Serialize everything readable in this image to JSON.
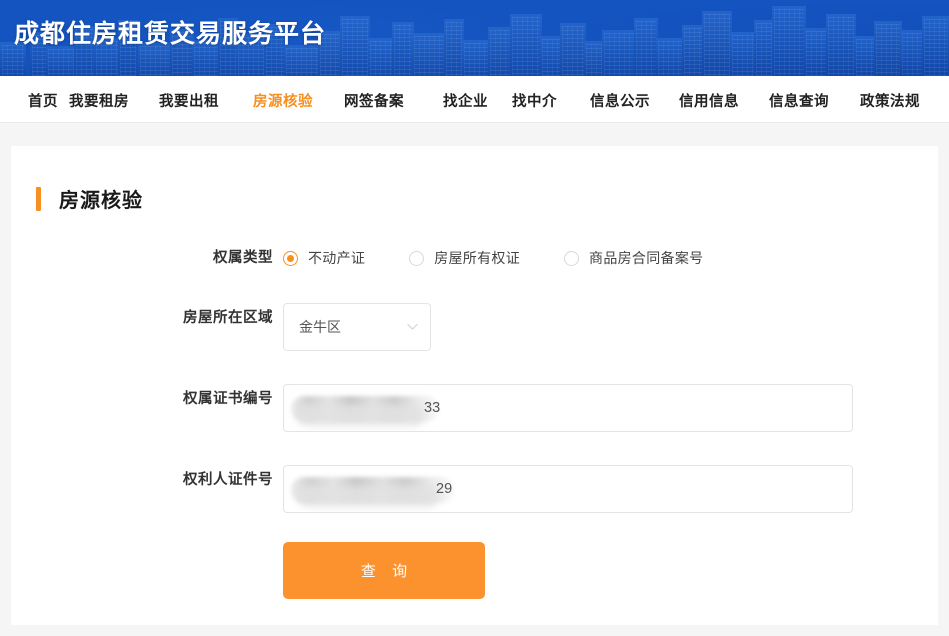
{
  "site": {
    "title": "成都住房租赁交易服务平台"
  },
  "nav": {
    "items": [
      {
        "label": "首页",
        "active": false
      },
      {
        "label": "我要租房",
        "active": false
      },
      {
        "label": "我要出租",
        "active": false
      },
      {
        "label": "房源核验",
        "active": true
      },
      {
        "label": "网签备案",
        "active": false
      },
      {
        "label": "找企业",
        "active": false
      },
      {
        "label": "找中介",
        "active": false
      },
      {
        "label": "信息公示",
        "active": false
      },
      {
        "label": "信用信息",
        "active": false
      },
      {
        "label": "信息查询",
        "active": false
      },
      {
        "label": "政策法规",
        "active": false
      }
    ]
  },
  "panel": {
    "title": "房源核验"
  },
  "form": {
    "ownership_type": {
      "label": "权属类型",
      "options": [
        {
          "label": "不动产证",
          "checked": true
        },
        {
          "label": "房屋所有权证",
          "checked": false
        },
        {
          "label": "商品房合同备案号",
          "checked": false
        }
      ]
    },
    "district": {
      "label": "房屋所在区域",
      "value": "金牛区",
      "icon": "chevron-down-icon"
    },
    "certificate_no": {
      "label": "权属证书编号",
      "value": "33",
      "redacted": true
    },
    "owner_id_no": {
      "label": "权利人证件号",
      "value": "29",
      "redacted": true
    },
    "submit": {
      "label": "查 询"
    }
  },
  "colors": {
    "brand_blue": "#1454c0",
    "accent_orange": "#f79021",
    "button_orange": "#fb922d",
    "page_background": "#f5f5f5",
    "panel_background": "#ffffff"
  }
}
